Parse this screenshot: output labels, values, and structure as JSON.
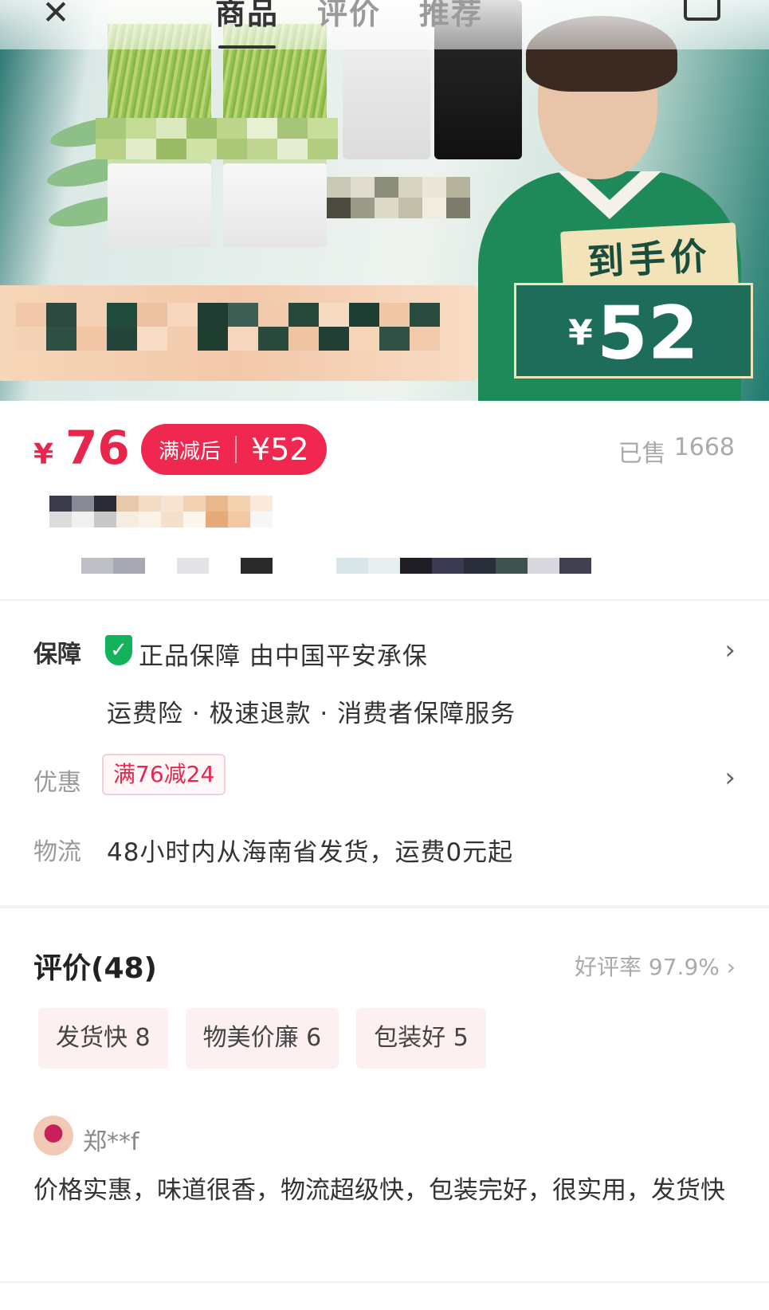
{
  "nav": {
    "close_icon": "close-icon",
    "tabs": [
      {
        "label": "商品",
        "active": true
      },
      {
        "label": "评价",
        "active": false
      },
      {
        "label": "推荐",
        "active": false
      }
    ],
    "cart_icon": "cart-icon"
  },
  "hero": {
    "tag_label": "到手价",
    "tag_currency": "¥",
    "tag_price": "52"
  },
  "price": {
    "currency": "¥",
    "current": "76",
    "after_label": "满减后",
    "after_price": "¥52",
    "sold_label": "已售",
    "sold_count": "1668"
  },
  "services": {
    "guarantee_label": "保障",
    "guarantee_text": "正品保障 由中国平安承保",
    "guarantee_sub": "运费险 · 极速退款 · 消费者保障服务",
    "discount_label": "优惠",
    "discount_coupon": "满76减24",
    "logistics_label": "物流",
    "logistics_text": "48小时内从海南省发货，运费0元起"
  },
  "reviews": {
    "title": "评价(48)",
    "rate": "好评率 97.9%",
    "tags": [
      {
        "label": "发货快 8"
      },
      {
        "label": "物美价廉 6"
      },
      {
        "label": "包装好 5"
      }
    ],
    "first": {
      "user": "郑**f",
      "text": "价格实惠，味道很香，物流超级快，包装完好，很实用，发货快"
    }
  },
  "colors": {
    "accent": "#e8264d",
    "shield": "#12b35a",
    "tag_bg": "#fdf0f1"
  }
}
